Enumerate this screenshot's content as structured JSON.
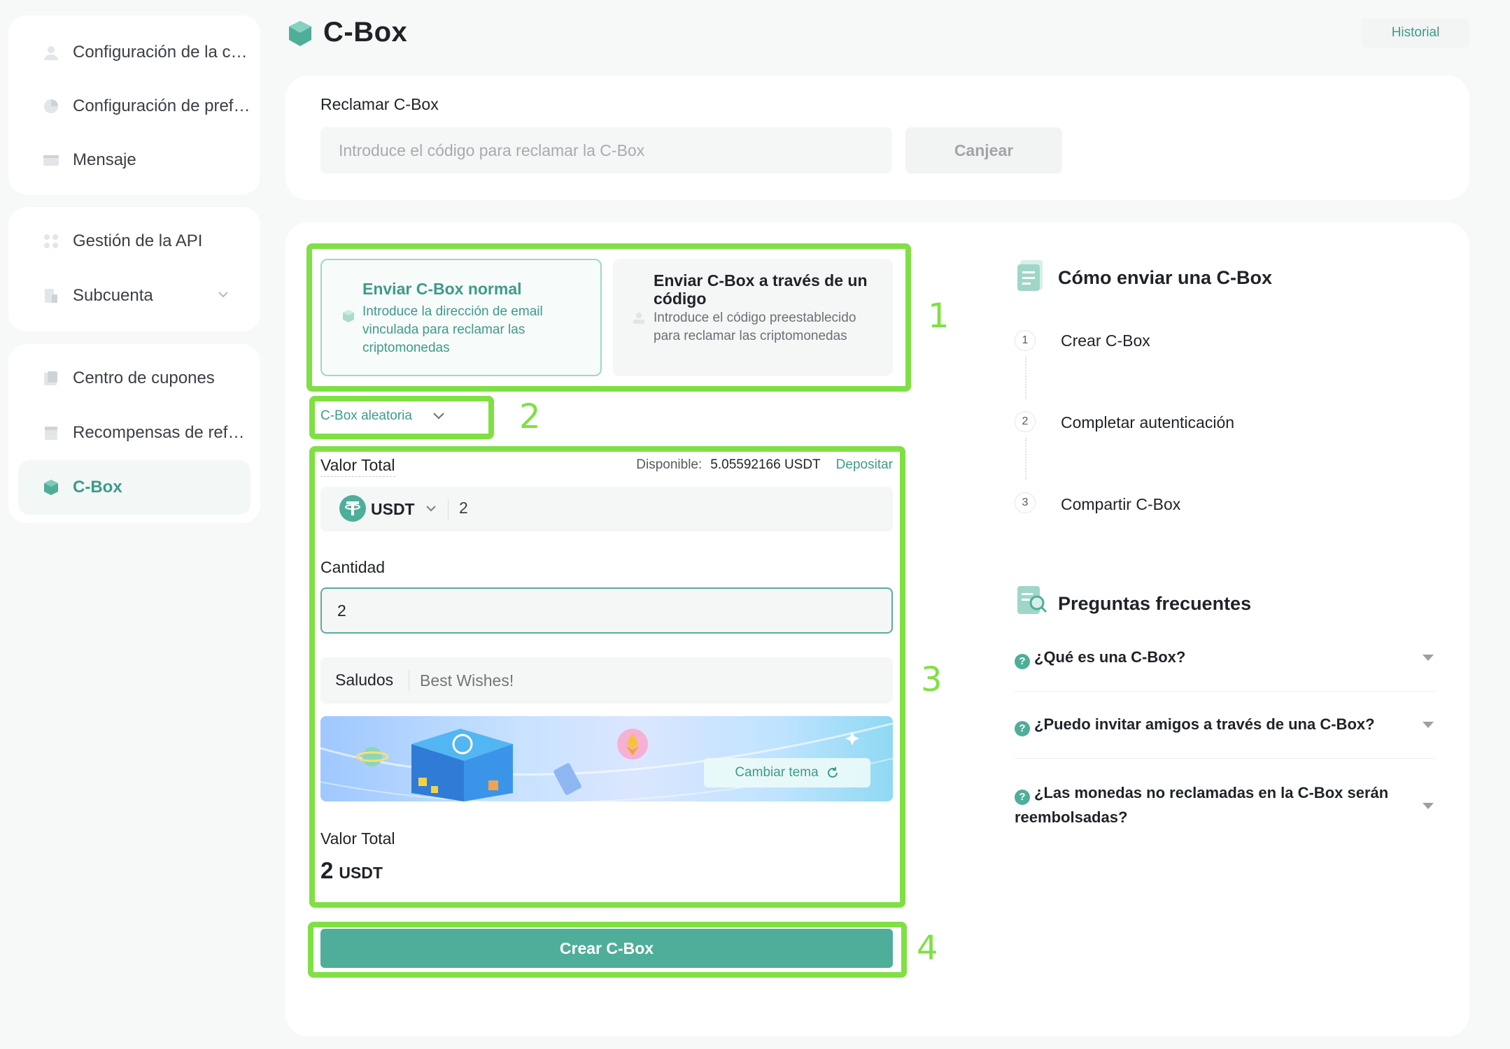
{
  "sidebar": {
    "group1": [
      {
        "label": "Configuración de la cuenta",
        "icon": "user-icon"
      },
      {
        "label": "Configuración de preferencias",
        "icon": "preferences-icon"
      },
      {
        "label": "Mensaje",
        "icon": "message-icon"
      }
    ],
    "group2": [
      {
        "label": "Gestión de la API",
        "icon": "api-icon"
      },
      {
        "label": "Subcuenta",
        "icon": "subaccount-icon"
      }
    ],
    "group3": [
      {
        "label": "Centro de cupones",
        "icon": "coupon-icon"
      },
      {
        "label": "Recompensas de referidos",
        "icon": "referral-icon"
      },
      {
        "label": "C-Box",
        "icon": "cbox-icon"
      }
    ]
  },
  "header": {
    "title": "C-Box",
    "history": "Historial"
  },
  "claim": {
    "label": "Reclamar C-Box",
    "placeholder": "Introduce el código para reclamar la C-Box",
    "button": "Canjear"
  },
  "send_options": [
    {
      "title": "Enviar C-Box normal",
      "description": "Introduce la dirección de email vinculada para reclamar las criptomonedas",
      "selected": true
    },
    {
      "title": "Enviar C-Box a través de un código",
      "description": "Introduce el código preestablecido para reclamar las criptomonedas",
      "selected": false
    }
  ],
  "box_type": "C-Box aleatoria",
  "form": {
    "total_label": "Valor Total",
    "available_label": "Disponible:",
    "available_value": "5.05592166 USDT",
    "deposit": "Depositar",
    "currency": "USDT",
    "amount": "2",
    "quantity_label": "Cantidad",
    "quantity": "2",
    "greeting_label": "Saludos",
    "greeting_placeholder": "Best Wishes!",
    "change_theme": "Cambiar tema",
    "summary_label": "Valor Total",
    "summary_value": "2",
    "summary_unit": "USDT",
    "create_button": "Crear C-Box"
  },
  "annotations": [
    "1",
    "2",
    "3",
    "4"
  ],
  "how_to": {
    "title": "Cómo enviar una C-Box",
    "steps": [
      {
        "num": "1",
        "text": "Crear C-Box"
      },
      {
        "num": "2",
        "text": "Completar autenticación"
      },
      {
        "num": "3",
        "text": "Compartir C-Box"
      }
    ]
  },
  "faq": {
    "title": "Preguntas frecuentes",
    "items": [
      "¿Qué es una C-Box?",
      "¿Puedo invitar amigos a través de una C-Box?",
      "¿Las monedas no reclamadas en la C-Box serán reembolsadas?"
    ]
  },
  "colors": {
    "accent": "#4fae99",
    "accent_text": "#3d9b8a",
    "annotation": "#7fe044"
  }
}
